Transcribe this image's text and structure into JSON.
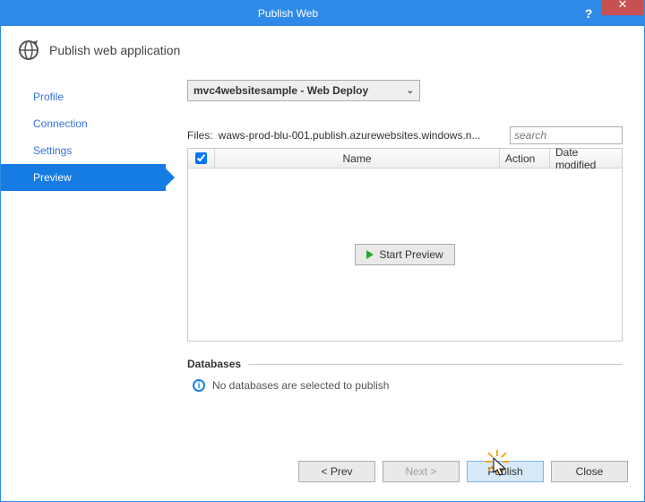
{
  "window": {
    "title": "Publish Web",
    "heading": "Publish web application"
  },
  "sidebar": {
    "items": [
      {
        "label": "Profile"
      },
      {
        "label": "Connection"
      },
      {
        "label": "Settings"
      },
      {
        "label": "Preview"
      }
    ],
    "selected_index": 3
  },
  "main": {
    "profile_selected": "mvc4websitesample - Web Deploy",
    "files_label": "Files:",
    "files_path": "waws-prod-blu-001.publish.azurewebsites.windows.n...",
    "search_placeholder": "search",
    "grid": {
      "columns": {
        "name": "Name",
        "action": "Action",
        "date": "Date modified"
      }
    },
    "start_preview_label": "Start Preview",
    "databases_heading": "Databases",
    "databases_note": "No databases are selected to publish"
  },
  "footer": {
    "prev": "< Prev",
    "next": "Next >",
    "publish": "Publish",
    "close": "Close"
  }
}
